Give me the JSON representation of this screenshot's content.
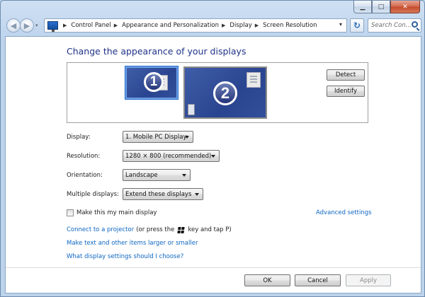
{
  "window": {
    "caption_buttons": [
      "minimize-icon",
      "maximize-icon",
      "close-icon"
    ]
  },
  "address_bar": {
    "crumbs": [
      "Control Panel",
      "Appearance and Personalization",
      "Display",
      "Screen Resolution"
    ],
    "search_placeholder": "Search Con..."
  },
  "main": {
    "title": "Change the appearance of your displays",
    "monitors": [
      {
        "number": "1",
        "selected": true
      },
      {
        "number": "2",
        "selected": false
      }
    ],
    "detect_label": "Detect",
    "identify_label": "Identify",
    "fields": {
      "display": {
        "label": "Display:",
        "value": "1. Mobile PC Display"
      },
      "resolution": {
        "label": "Resolution:",
        "value": "1280 × 800 (recommended)"
      },
      "orientation": {
        "label": "Orientation:",
        "value": "Landscape"
      },
      "multiple": {
        "label": "Multiple displays:",
        "value": "Extend these displays"
      }
    },
    "main_display_label": "Make this my main display",
    "advanced_settings": "Advanced settings",
    "projector_link": "Connect to a projector",
    "projector_text_1": "(or press the",
    "projector_text_2": "key and tap P)",
    "text_size_link": "Make text and other items larger or smaller",
    "help_link": "What display settings should I choose?"
  },
  "footer": {
    "ok_label": "OK",
    "cancel_label": "Cancel",
    "apply_label": "Apply"
  },
  "colors": {
    "title": "#1e3287",
    "link": "#0e66c3",
    "monitor_fill": "#2a4590",
    "selection": "#6ca0e8"
  }
}
